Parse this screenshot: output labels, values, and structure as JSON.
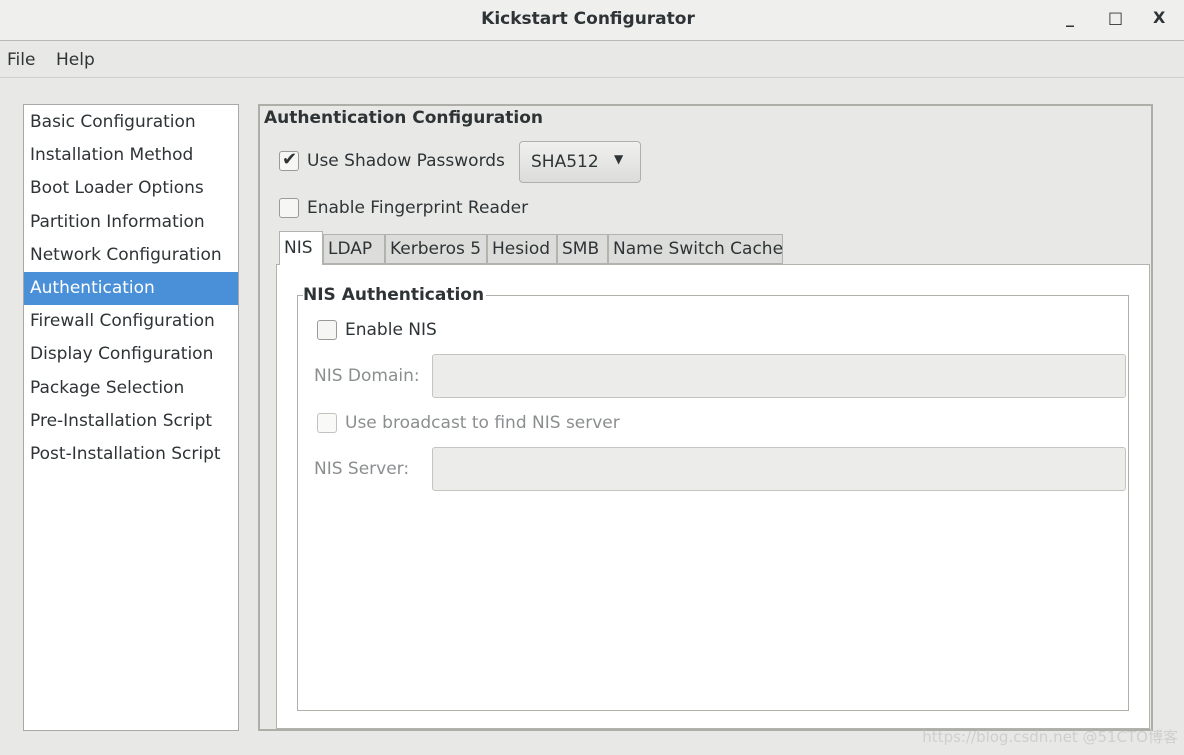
{
  "window": {
    "title": "Kickstart Configurator",
    "minimize": "_",
    "maximize": "□",
    "close": "X"
  },
  "menu": [
    "File",
    "Help"
  ],
  "sidebar": {
    "items": [
      "Basic Configuration",
      "Installation Method",
      "Boot Loader Options",
      "Partition Information",
      "Network Configuration",
      "Authentication",
      "Firewall Configuration",
      "Display Configuration",
      "Package Selection",
      "Pre-Installation Script",
      "Post-Installation Script"
    ],
    "selected": "Authentication"
  },
  "auth": {
    "title": "Authentication Configuration",
    "shadow": {
      "label": "Use Shadow Passwords",
      "checked": true
    },
    "hash": {
      "value": "SHA512"
    },
    "fingerprint": {
      "label": "Enable Fingerprint Reader",
      "checked": false
    },
    "tabs": [
      "NIS",
      "LDAP",
      "Kerberos 5",
      "Hesiod",
      "SMB",
      "Name Switch Cache"
    ],
    "active_tab": "NIS",
    "nis": {
      "title": "NIS Authentication",
      "enable_label": "Enable NIS",
      "enable_checked": false,
      "domain_label": "NIS Domain:",
      "domain_value": "",
      "broadcast_label": "Use broadcast to find NIS server",
      "broadcast_checked": false,
      "server_label": "NIS Server:",
      "server_value": ""
    }
  },
  "watermark": "https://blog.csdn.net @51CTO博客",
  "colors": {
    "selection": "#4a90d9"
  }
}
